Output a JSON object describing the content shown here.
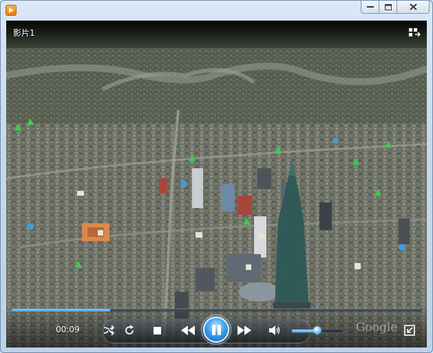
{
  "window": {
    "title": "",
    "controls": {
      "minimize_icon": "minimize-icon",
      "maximize_icon": "maximize-icon",
      "close_icon": "close-icon"
    }
  },
  "player": {
    "video_title": "影片1",
    "elapsed_time": "00:09",
    "seek_progress": 0.24,
    "volume": 0.5,
    "watermark": "Google",
    "icons": [
      "switch-to-library-icon",
      "shuffle-icon",
      "repeat-icon",
      "stop-icon",
      "previous-icon",
      "pause-icon",
      "next-icon",
      "volume-icon",
      "fullscreen-icon"
    ]
  },
  "colors": {
    "accent": "#2a8fe0",
    "titlebar": "#c6d9ee"
  }
}
